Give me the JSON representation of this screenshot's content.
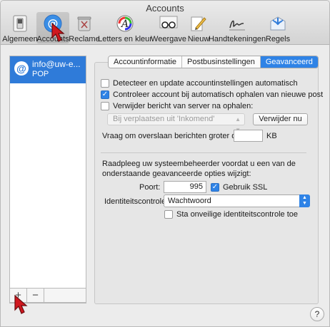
{
  "window": {
    "title": "Accounts"
  },
  "toolbar": {
    "items": [
      {
        "label": "Algemeen",
        "icon": "switch-icon"
      },
      {
        "label": "Accounts",
        "icon": "at-icon",
        "active": true
      },
      {
        "label": "Reclame",
        "icon": "trash-icon"
      },
      {
        "label": "Letters en kleur",
        "icon": "font-icon"
      },
      {
        "label": "Weergave",
        "icon": "glasses-icon"
      },
      {
        "label": "Nieuw",
        "icon": "pencil-icon"
      },
      {
        "label": "Handtekeningen",
        "icon": "signature-icon"
      },
      {
        "label": "Regels",
        "icon": "rules-icon"
      }
    ]
  },
  "accounts": {
    "items": [
      {
        "name": "info@uw-e...",
        "type": "POP",
        "selected": true
      }
    ],
    "add_label": "+",
    "remove_label": "−"
  },
  "tabs": {
    "items": [
      {
        "label": "Accountinformatie"
      },
      {
        "label": "Postbusinstellingen"
      },
      {
        "label": "Geavanceerd",
        "selected": true
      }
    ]
  },
  "advanced": {
    "detect_label": "Detecteer en update accountinstellingen automatisch",
    "detect_checked": false,
    "include_label": "Controleer account bij automatisch ophalen van nieuwe post",
    "include_checked": true,
    "remove_label": "Verwijder bericht van server na ophalen:",
    "remove_checked": false,
    "remove_option": "Bij verplaatsen uit 'Inkomend'",
    "remove_now_button": "Verwijder nu",
    "skip_label": "Vraag om overslaan berichten groter dan",
    "skip_value": "",
    "skip_unit": "KB",
    "admin_note_line1": "Raadpleeg uw systeembeheerder voordat u een van de",
    "admin_note_line2": "onderstaande geavanceerde opties wijzigt:",
    "port_label": "Poort:",
    "port_value": "995",
    "ssl_label": "Gebruik SSL",
    "ssl_checked": true,
    "auth_label": "Identiteitscontrole:",
    "auth_value": "Wachtwoord",
    "insecure_label": "Sta onveilige identiteitscontrole toe",
    "insecure_checked": false
  },
  "help": {
    "label": "?"
  },
  "colors": {
    "accent": "#2f83e6",
    "selection": "#2f7bd9",
    "annotation_cursor": "#d0181f"
  }
}
